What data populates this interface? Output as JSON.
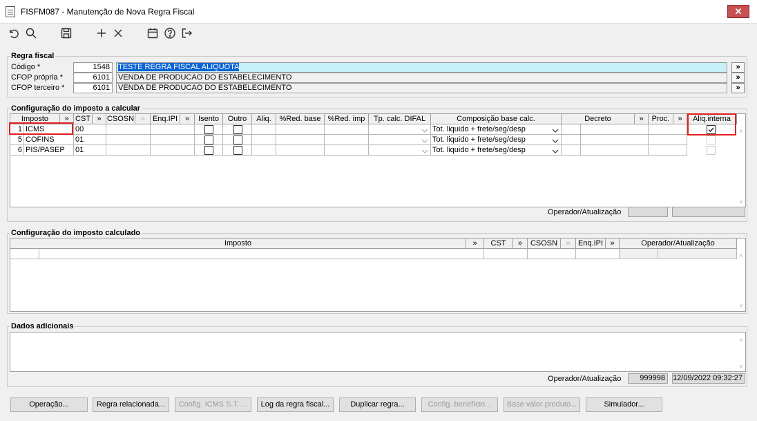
{
  "window": {
    "title": "FISFM087 - Manutenção de Nova Regra Fiscal",
    "close_label": "✕"
  },
  "toolbar": {
    "icons": [
      "undo-icon",
      "search-icon",
      "save-icon",
      "add-icon",
      "delete-icon",
      "calendar-icon",
      "help-icon",
      "exit-icon"
    ]
  },
  "regra_fiscal": {
    "label": "Regra fiscal",
    "codigo_label": "Código *",
    "codigo_value": "1548",
    "codigo_desc": "TESTE REGRA FISCAL ALIQUOTA",
    "cfop_propria_label": "CFOP própria *",
    "cfop_propria_value": "6101",
    "cfop_propria_desc": "VENDA DE PRODUCAO DO ESTABELECIMENTO",
    "cfop_terceiro_label": "CFOP terceiro *",
    "cfop_terceiro_value": "6101",
    "cfop_terceiro_desc": "VENDA DE PRODUCAO DO ESTABELECIMENTO",
    "lookup_label": "»"
  },
  "imposto_calcular": {
    "label": "Configuração do imposto a calcular",
    "headers": {
      "imposto": "Imposto",
      "lk1": "»",
      "cst": "CST",
      "lk2": "»",
      "csosn": "CSOSN",
      "lk3": "»",
      "enq_ipi": "Enq.IPI",
      "lk4": "»",
      "isento": "Isento",
      "outro": "Outro",
      "aliq": "Aliq.",
      "red_base": "%Red. base",
      "red_imp": "%Red. imp",
      "tp_calc": "Tp. calc. DIFAL",
      "composicao": "Composição base calc.",
      "decreto": "Decreto",
      "lk5": "»",
      "proc": "Proc.",
      "lk6": "»",
      "aliq_interna": "Aliq.interna"
    },
    "rows": [
      {
        "num": "1",
        "imposto": "ICMS",
        "cst": "00",
        "composicao": "Tot. liquido + frete/seg/desp",
        "isento": false,
        "outro": false,
        "aliq_interna": true
      },
      {
        "num": "5",
        "imposto": "COFINS",
        "cst": "01",
        "composicao": "Tot. liquido + frete/seg/desp",
        "isento": false,
        "outro": false,
        "aliq_interna": false
      },
      {
        "num": "6",
        "imposto": "PIS/PASEP",
        "cst": "01",
        "composicao": "Tot. liquido + frete/seg/desp",
        "isento": false,
        "outro": false,
        "aliq_interna": false
      }
    ],
    "operador_label": "Operador/Atualização"
  },
  "imposto_calculado": {
    "label": "Configuração do imposto calculado",
    "headers": {
      "imposto": "Imposto",
      "lk1": "»",
      "cst": "CST",
      "lk2": "»",
      "csosn": "CSOSN",
      "lk3": "»",
      "enq_ipi": "Enq.IPI",
      "lk4": "»",
      "operador": "Operador/Atualização"
    }
  },
  "dados_adicionais": {
    "label": "Dados adicionais",
    "operador_label": "Operador/Atualização",
    "operador_value": "999998",
    "atualizacao_value": "12/09/2022 09:32:27"
  },
  "buttons": {
    "operacao": "Operação...",
    "regra_relacionada": "Regra relacionada...",
    "config_icms_st": "Config. ICMS S.T. ...",
    "log_regra": "Log da regra fiscal...",
    "duplicar": "Duplicar regra...",
    "config_beneficio": "Config. benefício...",
    "base_valor": "Base valor produto...",
    "simulador": "Simulador..."
  },
  "colors": {
    "highlight_red": "#e02020",
    "selection_blue": "#0a64d6",
    "selected_field_bg": "#c8f0f8",
    "close_red": "#c75050"
  }
}
